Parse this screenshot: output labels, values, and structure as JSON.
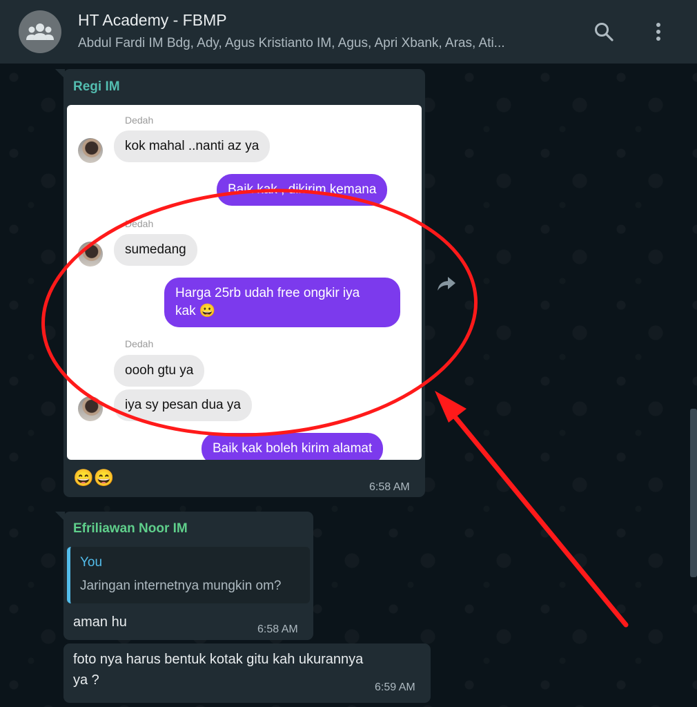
{
  "header": {
    "title": "HT Academy - FBMP",
    "subtitle": "Abdul Fardi IM Bdg, Ady, Agus Kristianto IM, Agus, Apri Xbank, Aras, Ati...",
    "icons": {
      "avatar": "group-icon",
      "search": "search-icon",
      "menu": "more-vertical-icon"
    }
  },
  "colors": {
    "header_bg": "#202c33",
    "chat_bg": "#0b141a",
    "bubble_bg": "#202c33",
    "sender_regi": "#53bdb0",
    "sender_efri": "#5fcf8b",
    "quote_bar": "#53bdeb",
    "annotation_red": "#ff1a1a",
    "screenshot_outgoing": "#7c3aed"
  },
  "messages": [
    {
      "sender": "Regi IM",
      "image_chat": {
        "rows": [
          {
            "from": "Dedah",
            "text": "kok mahal ..nanti az ya"
          },
          {
            "out": "Baik kak , dikirim kemana"
          },
          {
            "from": "Dedah",
            "text": "sumedang"
          },
          {
            "out_line1": "Harga 25rb udah free ongkir iya",
            "out_line2": "kak 😀"
          },
          {
            "from": "Dedah",
            "text": "oooh  gtu ya"
          },
          {
            "text": "iya sy pesan dua ya"
          },
          {
            "out": "Baik kak boleh kirim alamat"
          }
        ]
      },
      "caption": "😄😄",
      "time": "6:58 AM"
    },
    {
      "sender": "Efriliawan Noor IM",
      "quote": {
        "author": "You",
        "text": "Jaringan internetnya mungkin om?"
      },
      "text": "aman hu",
      "time": "6:58 AM"
    },
    {
      "text_line1": "foto nya harus bentuk kotak gitu kah ukurannya",
      "text_line2": "ya ?",
      "time": "6:59 AM"
    }
  ]
}
